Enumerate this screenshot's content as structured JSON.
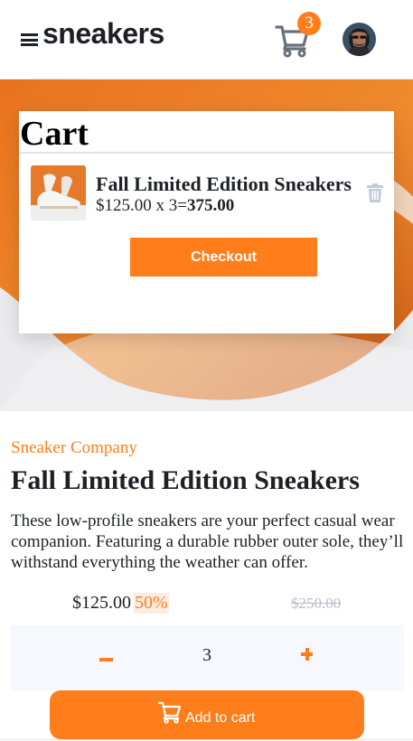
{
  "header": {
    "logo": "sneakers",
    "cart_count": "3"
  },
  "cart": {
    "title": "Cart",
    "item": {
      "name": "Fall Limited Edition Sneakers",
      "unit_price": "$125.00 x 3=",
      "total": "375.00"
    },
    "checkout_label": "Checkout"
  },
  "product": {
    "company": "Sneaker Company",
    "title": "Fall Limited Edition Sneakers",
    "description": "These low-profile sneakers are your perfect casual wear companion. Featuring a durable rubber outer sole, they’ll withstand everything the weather can offer.",
    "price": "$125.00",
    "discount": "50%",
    "old_price": "$250.00"
  },
  "quantity": {
    "value": "3"
  },
  "add_to_cart_label": "Add to cart",
  "colors": {
    "accent": "#ff7e1b",
    "accent_pale": "#ffede0",
    "dark_text": "#1d2026",
    "muted": "#b6bcc8",
    "qty_bg": "#f6f8fd"
  }
}
